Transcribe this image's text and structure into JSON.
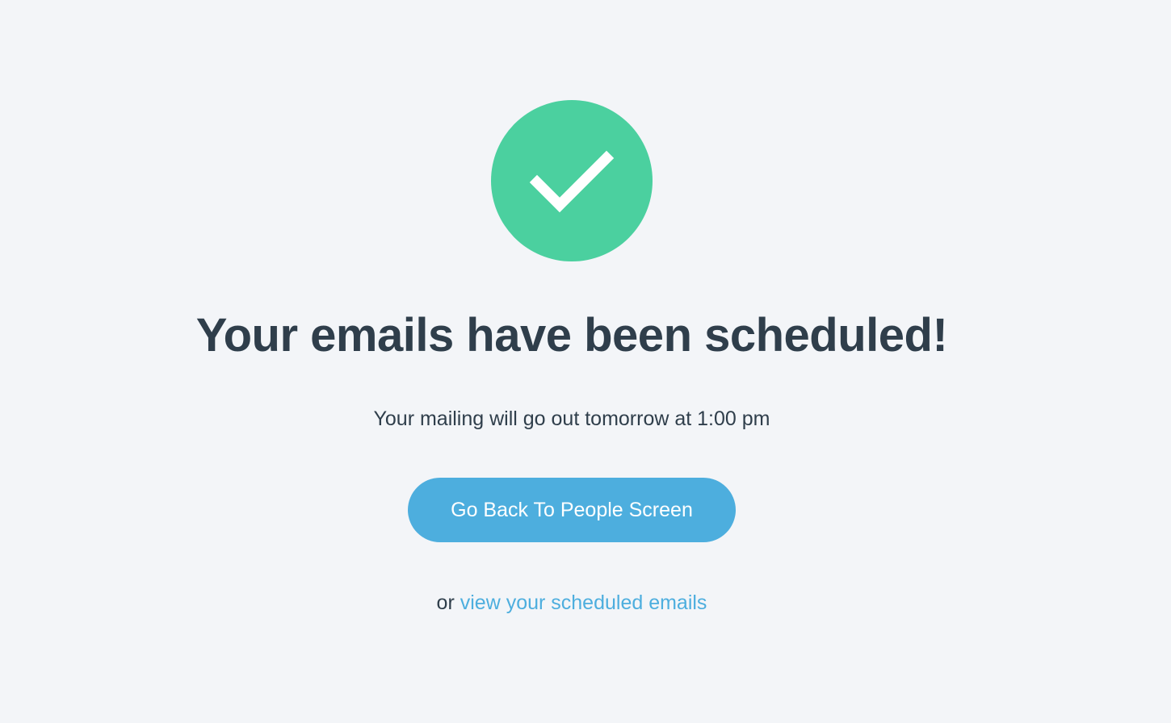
{
  "success": {
    "icon": "checkmark-icon",
    "badge_color": "#4bd09f"
  },
  "headline": "Your emails have been scheduled!",
  "subtext": "Your mailing will go out tomorrow at 1:00 pm",
  "primary_button": {
    "label": "Go Back To People Screen",
    "color": "#4daede"
  },
  "secondary": {
    "prefix": "or",
    "link_label": "view your scheduled emails",
    "link_color": "#4daede"
  }
}
